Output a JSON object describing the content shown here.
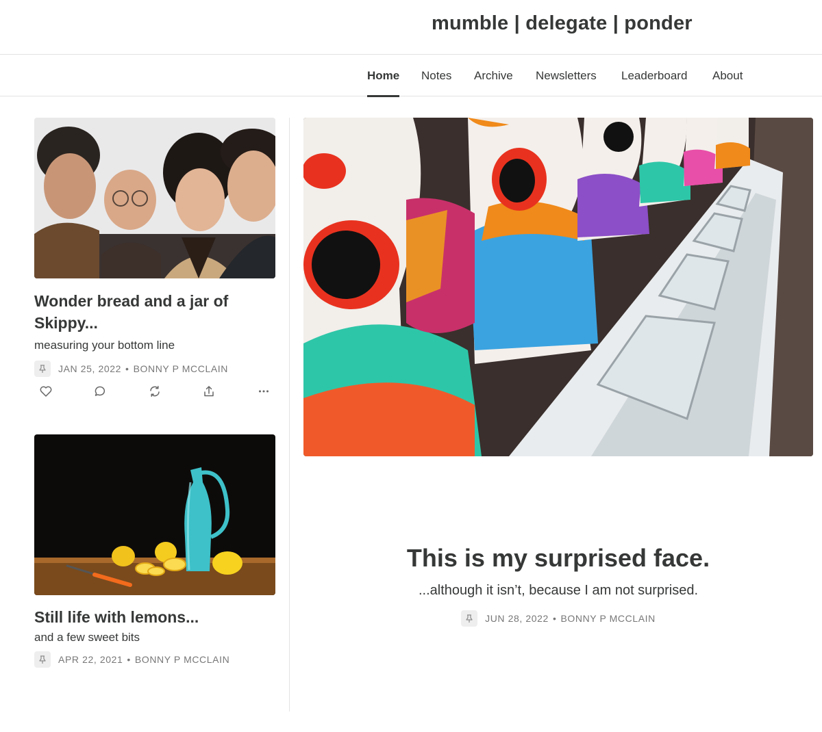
{
  "site": {
    "title": "mumble | delegate | ponder"
  },
  "nav": {
    "items": [
      {
        "label": "Home",
        "active": true
      },
      {
        "label": "Notes",
        "active": false
      },
      {
        "label": "Archive",
        "active": false
      },
      {
        "label": "Newsletters",
        "active": false
      },
      {
        "label": "Leaderboard",
        "active": false
      },
      {
        "label": "About",
        "active": false
      }
    ]
  },
  "hero": {
    "image": "clown-heads-carnival-game",
    "title": "This is my surprised face.",
    "subtitle": "...although it isn’t, because I am not surprised.",
    "date": "JUN 28, 2022",
    "author": "BONNY P MCCLAIN",
    "separator": "•"
  },
  "posts": [
    {
      "image": "four-people-group-photo",
      "title": "Wonder bread and a jar of Skippy...",
      "subtitle": "measuring your bottom line",
      "date": "JAN 25, 2022",
      "author": "BONNY P MCCLAIN",
      "separator": "•",
      "actions": [
        "heart-icon",
        "comment-icon",
        "restack-icon",
        "share-icon",
        "more-icon"
      ]
    },
    {
      "image": "still-life-lemons-turquoise-jug",
      "title": "Still life with lemons...",
      "subtitle": "and a few sweet bits",
      "date": "APR 22, 2021",
      "author": "BONNY P MCCLAIN",
      "separator": "•"
    }
  ],
  "colors": {
    "text": "#363737",
    "meta": "#777777",
    "divider": "#e3e3e3"
  }
}
